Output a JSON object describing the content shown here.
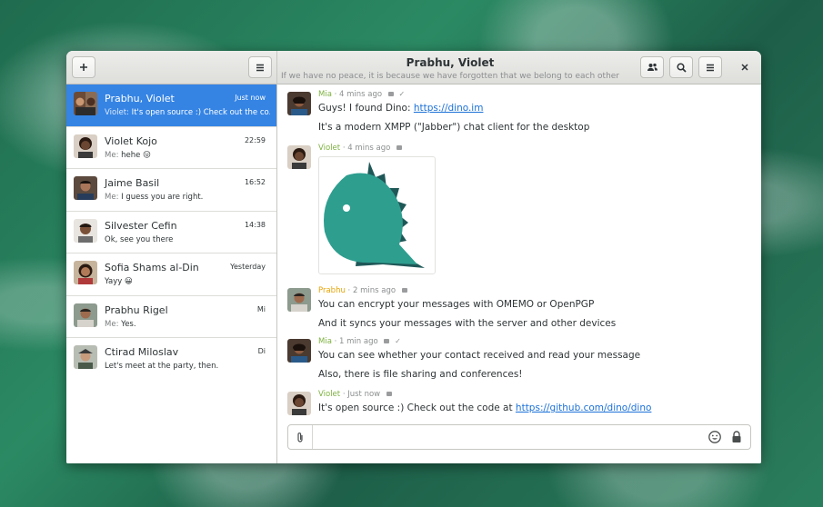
{
  "header": {
    "title": "Prabhu, Violet",
    "subtitle": "If we have no peace, it is because we have forgotten that we belong to each other",
    "add_icon": "plus-icon",
    "menu_icon": "hamburger-icon",
    "members_icon": "people-icon",
    "search_icon": "search-icon",
    "close_icon": "close-icon"
  },
  "conversations": [
    {
      "name": "Prabhu, Violet",
      "time": "Just now",
      "sender": "Violet:",
      "text": " It's open source :) Check out the co...",
      "selected": true
    },
    {
      "name": "Violet Kojo",
      "time": "22:59",
      "sender": "Me:",
      "text": " hehe 😛"
    },
    {
      "name": "Jaime Basil",
      "time": "16:52",
      "sender": "Me:",
      "text": " I guess you are right."
    },
    {
      "name": "Silvester Cefin",
      "time": "14:38",
      "sender": "",
      "text": "Ok, see you there"
    },
    {
      "name": "Sofia Shams al-Din",
      "time": "Yesterday",
      "sender": "",
      "text": "Yayy 😀"
    },
    {
      "name": "Prabhu Rigel",
      "time": "Mi",
      "sender": "Me:",
      "text": " Yes."
    },
    {
      "name": "Ctirad Miloslav",
      "time": "Di",
      "sender": "",
      "text": "Let's meet at the party, then."
    }
  ],
  "messages": [
    {
      "nick": "Mia",
      "time": "4 mins ago",
      "color": "#7db13f",
      "lines": [
        {
          "pre": "Guys! I found Dino: ",
          "link": "https://dino.im"
        },
        {
          "pre": "It's a modern XMPP (\"Jabber\") chat client for the desktop",
          "link": ""
        }
      ]
    },
    {
      "nick": "Violet",
      "time": "4 mins ago",
      "color": "#7db13f"
    },
    {
      "nick": "Prabhu",
      "time": "2 mins ago",
      "color": "#e5a50a",
      "lines": [
        {
          "pre": "You can encrypt your messages with OMEMO or OpenPGP",
          "link": ""
        },
        {
          "pre": "And it syncs your messages with the server and other devices",
          "link": ""
        }
      ]
    },
    {
      "nick": "Mia",
      "time": "1 min ago",
      "color": "#7db13f",
      "lines": [
        {
          "pre": "You can see whether your contact received and read your message",
          "link": ""
        },
        {
          "pre": "Also, there is file sharing and conferences!",
          "link": ""
        }
      ]
    },
    {
      "nick": "Violet",
      "time": "Just now",
      "color": "#7db13f",
      "lines": [
        {
          "pre": "It's open source :) Check out the code at ",
          "link": "https://github.com/dino/dino"
        }
      ]
    }
  ],
  "composer": {
    "placeholder": "",
    "value": ""
  },
  "colors": {
    "accent": "#3584e4",
    "link": "#1c71d8",
    "dino_body": "#2e9e8f",
    "dino_spikes": "#1f5757"
  }
}
